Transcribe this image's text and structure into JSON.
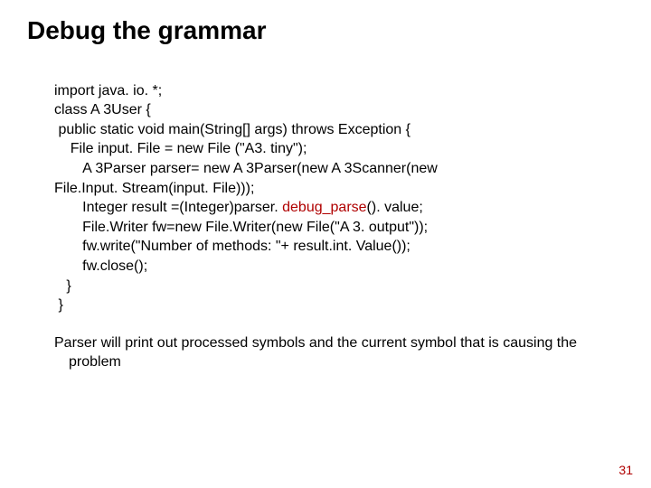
{
  "title": "Debug the grammar",
  "code": {
    "l1": "import java. io. *;",
    "l2": "class A 3User {",
    "l3": " public static void main(String[] args) throws Exception {",
    "l4": "    File input. File = new File (\"A3. tiny\");",
    "l5": "       A 3Parser parser= new A 3Parser(new A 3Scanner(new",
    "l6": "File.Input. Stream(input. File)));",
    "l7a": "       Integer result =(Integer)parser. ",
    "l7b": "debug_parse",
    "l7c": "(). value;",
    "l8": "       File.Writer fw=new File.Writer(new File(\"A 3. output\"));",
    "l9": "       fw.write(\"Number of methods: \"+ result.int. Value());",
    "l10": "       fw.close();",
    "l11": "   }",
    "l12": " }"
  },
  "note": "Parser will print out processed symbols and the current symbol that is causing the problem",
  "page_number": "31"
}
